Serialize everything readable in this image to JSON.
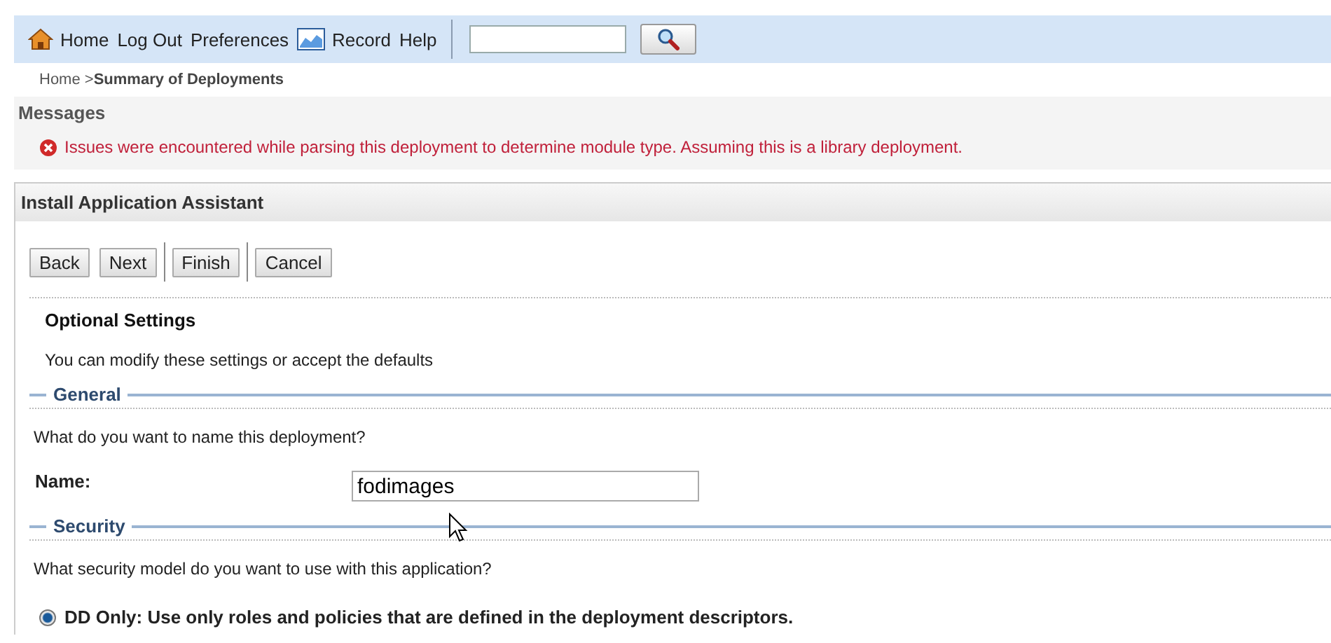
{
  "toolbar": {
    "links": [
      {
        "label": "Home"
      },
      {
        "label": "Log Out"
      },
      {
        "label": "Preferences"
      },
      {
        "label": "Record"
      },
      {
        "label": "Help"
      }
    ]
  },
  "breadcrumb": {
    "parent": "Home >",
    "current": "Summary of Deployments"
  },
  "messages": {
    "title": "Messages",
    "items": [
      {
        "kind": "error",
        "text": "Issues were encountered while parsing this deployment to determine module type. Assuming this is a library deployment."
      }
    ]
  },
  "panel": {
    "title": "Install Application Assistant",
    "buttons": [
      {
        "label": "Back",
        "separator_after": false
      },
      {
        "label": "Next",
        "separator_after": true
      },
      {
        "label": "Finish",
        "separator_after": true
      },
      {
        "label": "Cancel",
        "separator_after": false
      }
    ],
    "heading": "Optional Settings",
    "intro": "You can modify these settings or accept the defaults",
    "sections": [
      {
        "title": "General",
        "question": "What do you want to name this deployment?",
        "fields": [
          {
            "label": "Name:",
            "value": "fodimages"
          }
        ]
      },
      {
        "title": "Security",
        "question": "What security model do you want to use with this application?",
        "options": [
          {
            "label": "DD Only: Use only roles and policies that are defined in the deployment descriptors.",
            "selected": true
          }
        ]
      }
    ]
  }
}
